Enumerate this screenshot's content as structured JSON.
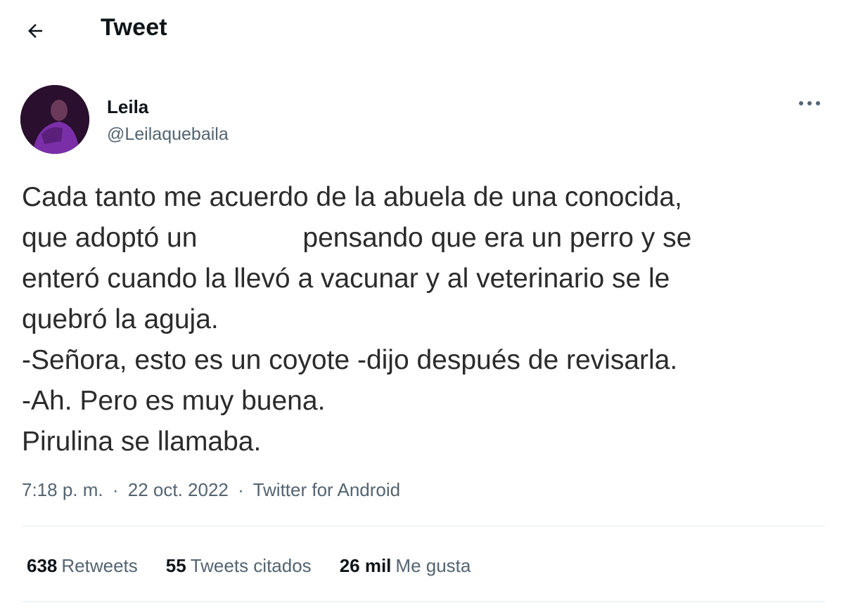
{
  "header": {
    "back_icon": "arrow-left-icon",
    "title": "Tweet"
  },
  "author": {
    "name": "Leila",
    "handle": "@Leilaquebaila",
    "avatar_colors": [
      "#2a0f2e",
      "#7a2fa8",
      "#5a1f7a"
    ],
    "more_icon": "more-horizontal-icon"
  },
  "tweet": {
    "line1": "Cada tanto me acuerdo de la abuela de una conocida,",
    "line2a": "que adoptó un",
    "line2b": "pensando que era un perro y se",
    "line3": "enteró cuando la llevó a vacunar y al veterinario se le",
    "line4": "quebró la aguja.",
    "line5": "-Señora, esto es un coyote -dijo después de revisarla.",
    "line6": "-Ah. Pero es muy buena.",
    "line7": "Pirulina se llamaba."
  },
  "meta": {
    "time": "7:18 p. m.",
    "date": "22 oct. 2022",
    "separator": "·",
    "source": "Twitter for Android"
  },
  "stats": [
    {
      "count": "638",
      "label": "Retweets"
    },
    {
      "count": "55",
      "label": "Tweets citados"
    },
    {
      "count": "26 mil",
      "label": "Me gusta"
    }
  ],
  "colors": {
    "text_primary": "#0f1419",
    "text_secondary": "#536471",
    "divider": "#e6ecf0"
  }
}
